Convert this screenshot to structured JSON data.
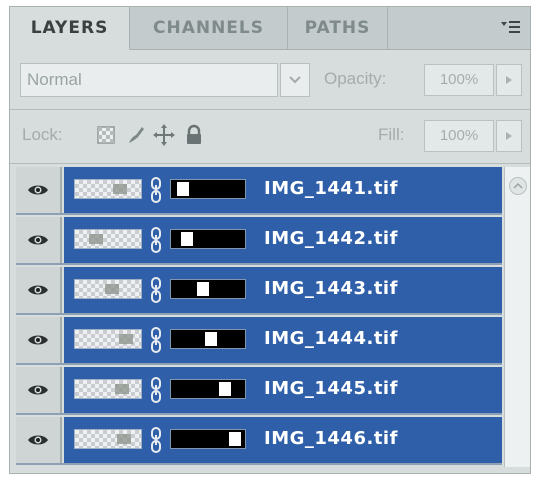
{
  "tabs": [
    {
      "label": "LAYERS",
      "active": true
    },
    {
      "label": "CHANNELS",
      "active": false
    },
    {
      "label": "PATHS",
      "active": false
    }
  ],
  "panel_menu_icon": "panel-menu-icon",
  "blend_mode": "Normal",
  "opacity": {
    "label": "Opacity:",
    "value": "100%"
  },
  "lock": {
    "label": "Lock:",
    "icons": [
      "lock-transparent-pixels-icon",
      "lock-image-pixels-icon",
      "lock-position-icon",
      "lock-all-icon"
    ]
  },
  "fill": {
    "label": "Fill:",
    "value": "100%"
  },
  "layers": [
    {
      "name": "IMG_1441.tif",
      "visible": true,
      "selected": true
    },
    {
      "name": "IMG_1442.tif",
      "visible": true,
      "selected": true
    },
    {
      "name": "IMG_1443.tif",
      "visible": true,
      "selected": true
    },
    {
      "name": "IMG_1444.tif",
      "visible": true,
      "selected": true
    },
    {
      "name": "IMG_1445.tif",
      "visible": true,
      "selected": true
    },
    {
      "name": "IMG_1446.tif",
      "visible": true,
      "selected": true
    }
  ],
  "colors": {
    "selection": "#2f5fa9",
    "panel_bg": "#d7dcdc",
    "tab_bar": "#c4cbcc",
    "layer_text": "#ffffff"
  }
}
